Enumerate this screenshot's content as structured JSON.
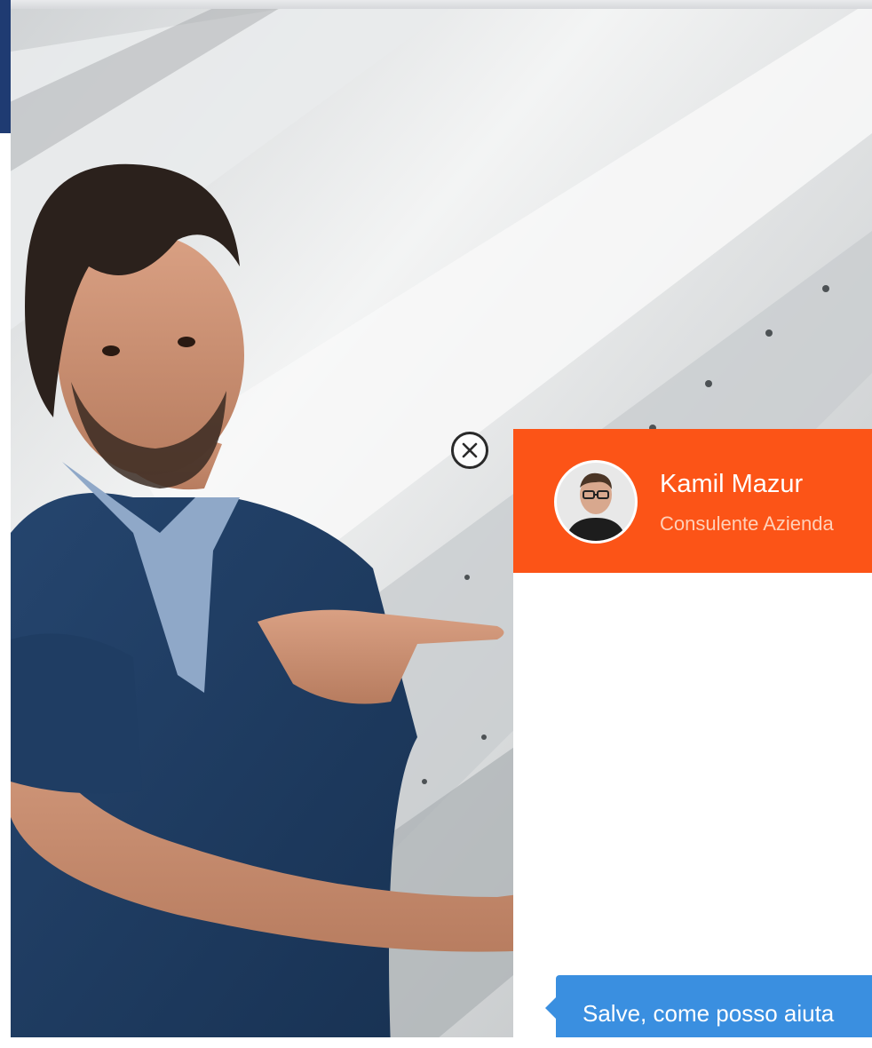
{
  "close_button": {
    "icon": "close-circle-icon"
  },
  "chat": {
    "agent": {
      "name": "Kamil Mazur",
      "role": "Consulente Azienda",
      "avatar_icon": "agent-avatar"
    },
    "message": "Salve, come posso aiuta"
  },
  "colors": {
    "header": "#fc5417",
    "bubble": "#3a8fe0",
    "left_bar": "#1f3b72"
  }
}
